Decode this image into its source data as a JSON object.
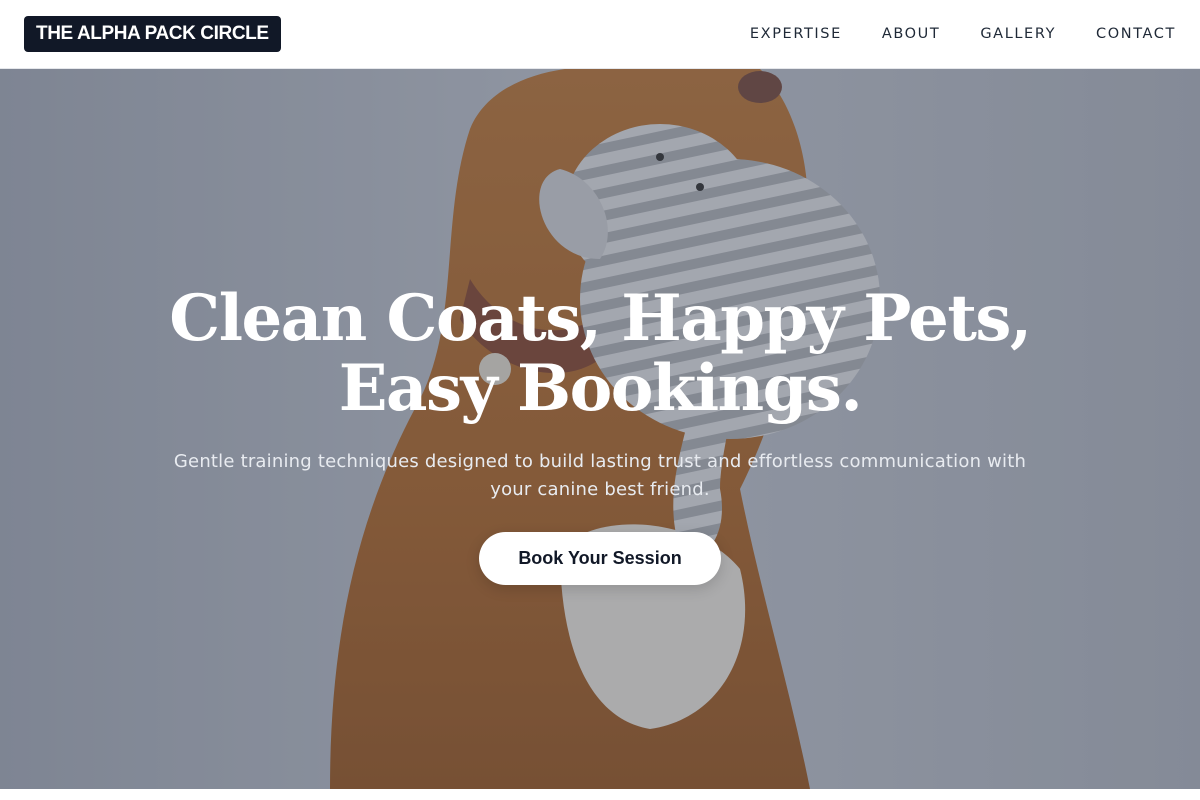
{
  "header": {
    "logo_text": "THE ALPHA PACK CIRCLE",
    "nav": [
      "EXPERTISE",
      "ABOUT",
      "GALLERY",
      "CONTACT"
    ]
  },
  "hero": {
    "title_line1": "Clean Coats, Happy Pets,",
    "title_line2": "Easy Bookings.",
    "subtitle": "Gentle training techniques designed to build lasting trust and effortless communication with your canine best friend.",
    "cta_label": "Book Your Session"
  },
  "colors": {
    "logo_bg": "#111827",
    "nav_text": "#1f2937",
    "hero_overlay": "#373e4e",
    "cta_bg": "#ffffff",
    "cta_text": "#111827"
  }
}
